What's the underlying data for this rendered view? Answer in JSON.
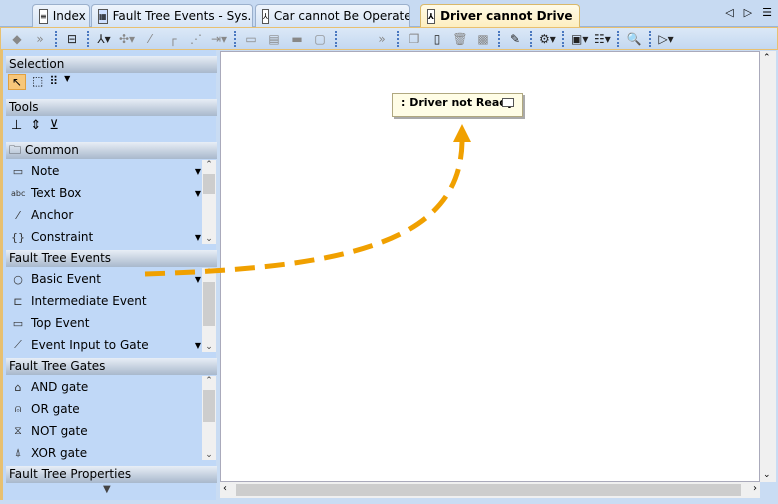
{
  "tabs": [
    {
      "label": "Index"
    },
    {
      "label": "Fault Tree  Events - Sys..."
    },
    {
      "label": "Car cannot Be Operated"
    },
    {
      "label": "Driver cannot Drive",
      "close": "×"
    }
  ],
  "palette": {
    "selection": "Selection",
    "tools": "Tools",
    "common": "Common",
    "common_items": [
      "Note",
      "Text Box",
      "Anchor",
      "Constraint"
    ],
    "fte": "Fault Tree Events",
    "fte_items": [
      "Basic Event",
      "Intermediate Event",
      "Top Event",
      "Event Input to Gate"
    ],
    "ftg": "Fault Tree Gates",
    "ftg_items": [
      "AND gate",
      "OR gate",
      "NOT gate",
      "XOR gate"
    ],
    "ftp": "Fault Tree Properties"
  },
  "diagram": {
    "element_label": ": Driver not Ready",
    "arrow_color": "#f0a000"
  }
}
